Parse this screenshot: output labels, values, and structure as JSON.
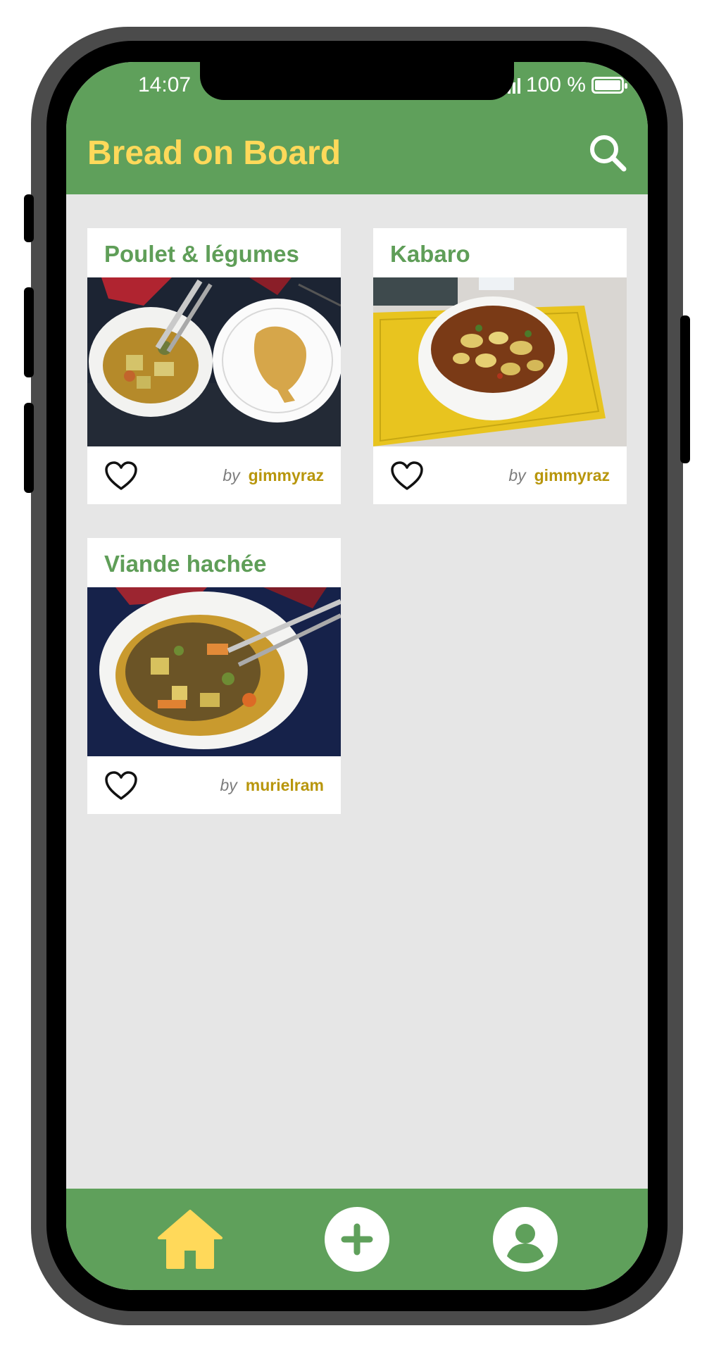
{
  "status_bar": {
    "time": "14:07",
    "battery": "100 %"
  },
  "header": {
    "title": "Bread on Board",
    "search_icon": "search-icon"
  },
  "colors": {
    "brand_green": "#5fa05b",
    "title_yellow": "#ffd95a",
    "author_gold": "#b8960c",
    "card_title_green": "#5f9e58"
  },
  "recipes": [
    {
      "title": "Poulet & légumes",
      "by_label": "by",
      "author": "gimmyraz",
      "like_icon": "heart-outline-icon"
    },
    {
      "title": "Kabaro",
      "by_label": "by",
      "author": "gimmyraz",
      "like_icon": "heart-outline-icon"
    },
    {
      "title": "Viande hachée",
      "by_label": "by",
      "author": "murielram",
      "like_icon": "heart-outline-icon"
    }
  ],
  "bottom_nav": [
    {
      "icon": "home-icon",
      "active": true
    },
    {
      "icon": "add-icon",
      "active": false
    },
    {
      "icon": "profile-icon",
      "active": false
    }
  ]
}
